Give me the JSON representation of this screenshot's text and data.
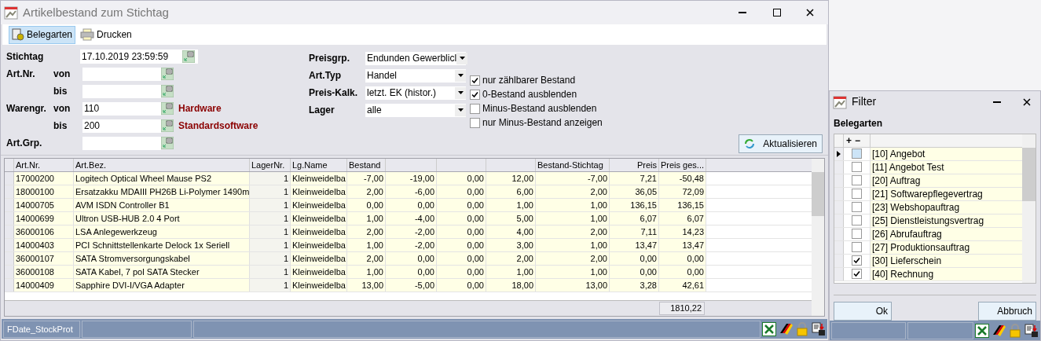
{
  "window": {
    "title": "Artikelbestand zum Stichtag"
  },
  "toolbar": [
    {
      "label": "Belegarten",
      "kind": "doc",
      "selected": true
    },
    {
      "label": "Drucken",
      "kind": "print",
      "selected": false
    }
  ],
  "form": {
    "stichtag": {
      "label": "Stichtag",
      "value": "17.10.2019 23:59:59"
    },
    "rows": [
      {
        "label": "Art.Nr.",
        "sub": "von"
      },
      {
        "sub": "bis"
      },
      {
        "label": "Warengr.",
        "sub": "von",
        "value": "110",
        "hint": "Hardware"
      },
      {
        "sub": "bis",
        "value": "200",
        "hint": "Standardsoftware"
      },
      {
        "label": "Art.Grp."
      }
    ],
    "selects": [
      {
        "label": "Preisgrp.",
        "value": "Endunden Gewerblicl"
      },
      {
        "label": "Art.Typ",
        "value": "Handel"
      },
      {
        "label": "Preis-Kalk.",
        "value": "letzt. EK (histor.)"
      },
      {
        "label": "Lager",
        "value": "alle"
      }
    ],
    "checks": [
      {
        "label": "nur zählbarer Bestand",
        "checked": true
      },
      {
        "label": "0-Bestand ausblenden",
        "checked": true
      },
      {
        "label": "Minus-Bestand ausblenden",
        "checked": false
      },
      {
        "label": "nur Minus-Bestand anzeigen",
        "checked": false
      }
    ],
    "refresh_button": "Aktualisieren"
  },
  "table": {
    "columns": [
      {
        "label": "Art.Nr."
      },
      {
        "label": "Art.Bez."
      },
      {
        "label": "LagerNr."
      },
      {
        "label": "Lg.Name"
      },
      {
        "label": "Bestand"
      },
      {},
      {},
      {},
      {
        "label": "Bestand-Stichtag"
      },
      {
        "label": "Preis"
      },
      {
        "label": "Preis ges..."
      }
    ],
    "rows": [
      [
        "17000200",
        "Logitech Optical Wheel Mause PS2",
        "1",
        "Kleinweidelba",
        "-7,00",
        "-19,00",
        "0,00",
        "12,00",
        "-7,00",
        "7,21",
        "-50,48"
      ],
      [
        "18000100",
        "Ersatzakku MDAIII PH26B Li-Polymer 1490m",
        "1",
        "Kleinweidelba",
        "2,00",
        "-6,00",
        "0,00",
        "6,00",
        "2,00",
        "36,05",
        "72,09"
      ],
      [
        "14000705",
        "AVM ISDN Controller B1",
        "1",
        "Kleinweidelba",
        "0,00",
        "0,00",
        "0,00",
        "1,00",
        "1,00",
        "136,15",
        "136,15"
      ],
      [
        "14000699",
        "Ultron USB-HUB 2.0 4 Port",
        "1",
        "Kleinweidelba",
        "1,00",
        "-4,00",
        "0,00",
        "5,00",
        "1,00",
        "6,07",
        "6,07"
      ],
      [
        "36000106",
        "LSA Anlegewerkzeug",
        "1",
        "Kleinweidelba",
        "2,00",
        "-2,00",
        "0,00",
        "4,00",
        "2,00",
        "7,11",
        "14,23"
      ],
      [
        "14000403",
        "PCI Schnittstellenkarte Delock 1x Seriell",
        "1",
        "Kleinweidelba",
        "1,00",
        "-2,00",
        "0,00",
        "3,00",
        "1,00",
        "13,47",
        "13,47"
      ],
      [
        "36000107",
        "SATA Stromversorgungskabel",
        "1",
        "Kleinweidelba",
        "2,00",
        "0,00",
        "0,00",
        "2,00",
        "2,00",
        "0,00",
        "0,00"
      ],
      [
        "36000108",
        "SATA Kabel, 7 pol SATA Stecker",
        "1",
        "Kleinweidelba",
        "1,00",
        "0,00",
        "0,00",
        "1,00",
        "1,00",
        "0,00",
        "0,00"
      ],
      [
        "14000409",
        "Sapphire DVI-I/VGA Adapter",
        "1",
        "Kleinweidelba",
        "13,00",
        "-5,00",
        "0,00",
        "18,00",
        "13,00",
        "3,28",
        "42,61"
      ]
    ],
    "total": "1810,22"
  },
  "status_bar": {
    "text": "FDate_StockProt"
  },
  "filter": {
    "title": "Filter",
    "heading": "Belegarten",
    "header": [
      "+",
      "−"
    ],
    "items": [
      {
        "label": "[10] Angebot",
        "checked": false,
        "selected": true
      },
      {
        "label": "[11] Angebot Test",
        "checked": false,
        "selected": false
      },
      {
        "label": "[20] Auftrag",
        "checked": false,
        "selected": false
      },
      {
        "label": "[21] Softwarepflegevertrag",
        "checked": false,
        "selected": false
      },
      {
        "label": "[23] Webshopauftrag",
        "checked": false,
        "selected": false
      },
      {
        "label": "[25] Dienstleistungsvertrag",
        "checked": false,
        "selected": false
      },
      {
        "label": "[26] Abrufauftrag",
        "checked": false,
        "selected": false
      },
      {
        "label": "[27] Produktionsauftrag",
        "checked": false,
        "selected": false
      },
      {
        "label": "[30] Lieferschein",
        "checked": true,
        "selected": false
      },
      {
        "label": "[40] Rechnung",
        "checked": true,
        "selected": false
      }
    ],
    "buttons": [
      "Ok",
      "Abbruch"
    ]
  }
}
